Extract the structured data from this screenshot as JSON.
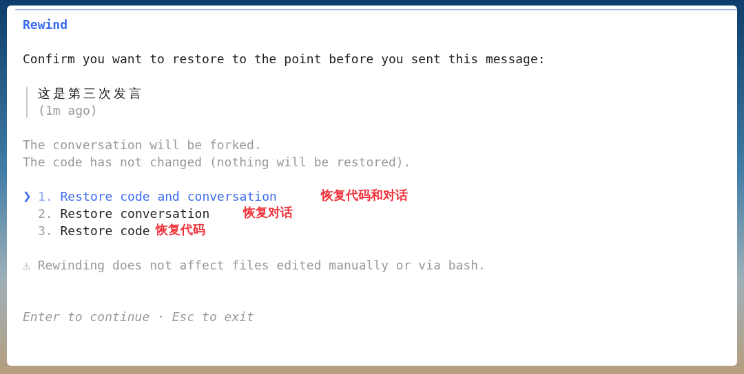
{
  "dialog": {
    "title": "Rewind",
    "prompt": "Confirm you want to restore to the point before you sent this message:",
    "quote": {
      "message": "这是第三次发言",
      "time": "(1m ago)"
    },
    "notes": [
      "The conversation will be forked.",
      "The code has not changed (nothing will be restored)."
    ],
    "pointer": "❯",
    "options": [
      {
        "number": "1.",
        "label": "Restore code and conversation",
        "selected": true,
        "annotation": "恢复代码和对话"
      },
      {
        "number": "2.",
        "label": "Restore conversation",
        "selected": false,
        "annotation": "恢复对话"
      },
      {
        "number": "3.",
        "label": "Restore code",
        "selected": false,
        "annotation": "恢复代码"
      }
    ],
    "warning": "⚠ Rewinding does not affect files edited manually or via bash.",
    "hint": "Enter to continue · Esc to exit"
  }
}
